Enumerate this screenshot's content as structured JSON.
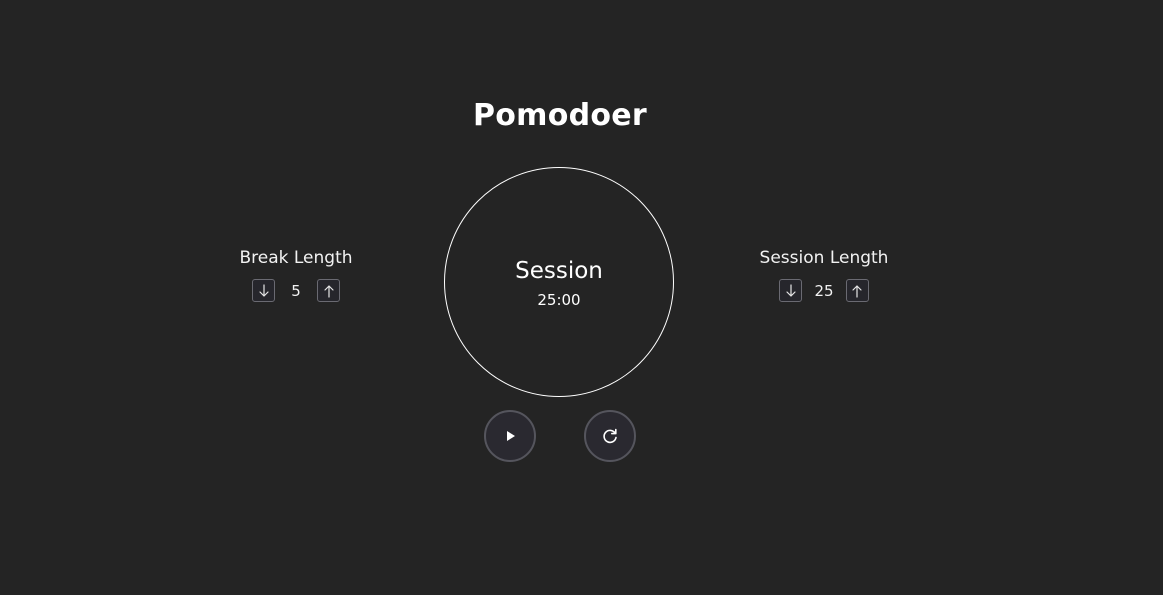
{
  "app": {
    "title": "Pomodoer"
  },
  "break": {
    "label": "Break Length",
    "value": "5",
    "decrement_icon": "arrow-down-icon",
    "increment_icon": "arrow-up-icon"
  },
  "session": {
    "label": "Session Length",
    "value": "25",
    "decrement_icon": "arrow-down-icon",
    "increment_icon": "arrow-up-icon"
  },
  "timer": {
    "mode": "Session",
    "time": "25:00"
  },
  "controls": {
    "play_icon": "play-icon",
    "reset_icon": "refresh-icon"
  },
  "colors": {
    "background": "#242424",
    "foreground": "#ffffff",
    "button_border": "#55555d"
  }
}
